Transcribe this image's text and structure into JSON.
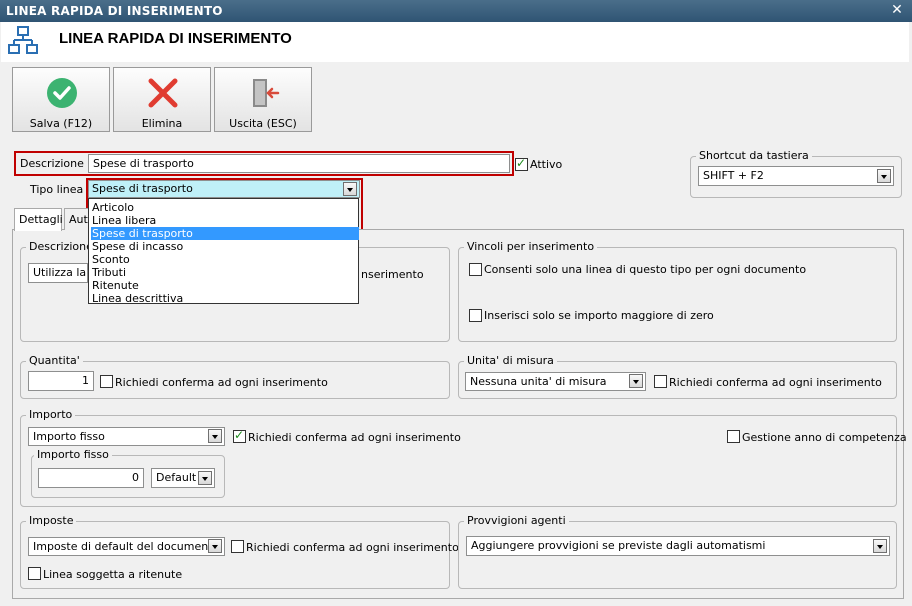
{
  "window": {
    "title": "LINEA RAPIDA DI INSERIMENTO",
    "close_glyph": "✕"
  },
  "header": {
    "title": "LINEA RAPIDA DI INSERIMENTO",
    "icon": "sitemap-icon"
  },
  "toolbar": {
    "save_label": "Salva (F12)",
    "delete_label": "Elimina",
    "exit_label": "Uscita (ESC)",
    "colors": {
      "save": "#3cb371",
      "delete": "#e03c31",
      "exit": "#d84a3a"
    }
  },
  "form": {
    "description_label": "Descrizione :",
    "description_value": "Spese di trasporto",
    "active_label": "Attivo",
    "active_checked": true,
    "type_label": "Tipo linea :",
    "type_value": "Spese di trasporto",
    "type_options": [
      "Articolo",
      "Linea libera",
      "Spese di trasporto",
      "Spese di incasso",
      "Sconto",
      "Tributi",
      "Ritenute",
      "Linea descrittiva"
    ],
    "type_selected_index": 2
  },
  "shortcut": {
    "legend": "Shortcut da tastiera",
    "value": "SHIFT + F2"
  },
  "tabs": [
    {
      "label": "Dettagli"
    },
    {
      "label": "Aut"
    }
  ],
  "description_group": {
    "legend": "Descrizione",
    "combo_value": "Utilizza la d",
    "confirm_label": "nserimento"
  },
  "vincoli": {
    "legend": "Vincoli per inserimento",
    "one_per_doc_label": "Consenti solo una linea di questo tipo per ogni documento",
    "only_if_positive_label": "Inserisci solo se importo maggiore di zero"
  },
  "quantita": {
    "legend": "Quantita'",
    "value": "1",
    "confirm_label": "Richiedi conferma ad ogni inserimento"
  },
  "unita": {
    "legend": "Unita' di misura",
    "value": "Nessuna unita' di misura",
    "confirm_label": "Richiedi conferma ad ogni inserimento"
  },
  "importo": {
    "legend": "Importo",
    "mode_value": "Importo fisso",
    "confirm_label": "Richiedi conferma ad ogni inserimento",
    "confirm_checked": true,
    "competenza_label": "Gestione anno di competenza",
    "fixed": {
      "legend": "Importo fisso",
      "value": "0",
      "currency_value": "Default"
    }
  },
  "imposte": {
    "legend": "Imposte",
    "value": "Imposte di default del documento",
    "confirm_label": "Richiedi conferma ad ogni inserimento",
    "ritenute_label": "Linea soggetta a ritenute"
  },
  "provvigioni": {
    "legend": "Provvigioni agenti",
    "value": "Aggiungere provvigioni se previste dagli automatismi"
  }
}
